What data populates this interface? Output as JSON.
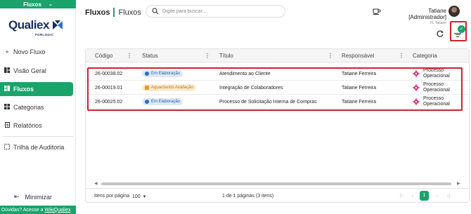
{
  "module": {
    "label": "Fluxos"
  },
  "logo": {
    "text": "Qualiex",
    "subtext": "FORLOGIC"
  },
  "sidebar": {
    "items": [
      {
        "icon": "plus-icon",
        "label": "Novo Fluxo"
      },
      {
        "icon": "dashboard-icon",
        "label": "Visão Geral"
      },
      {
        "icon": "flows-icon",
        "label": "Fluxos",
        "active": true
      },
      {
        "icon": "categories-icon",
        "label": "Categorias"
      },
      {
        "icon": "report-icon",
        "label": "Relatórios"
      },
      {
        "icon": "audit-trail-icon",
        "label": "Trilha de Auditoria"
      }
    ],
    "minimize_label": "Minimizar",
    "footer_prefix": "Dúvidas? Acesse a",
    "footer_link": "WikiQualiex"
  },
  "header": {
    "title": "Fluxos",
    "breadcrumb": "Fluxos",
    "search_placeholder": "Digite para buscar...",
    "user_name": "Tatiane [Administrador]",
    "user_org": "FL Tatiane"
  },
  "filter": {
    "badge": "✓"
  },
  "table": {
    "columns": [
      "Código",
      "Status",
      "Título",
      "Responsável",
      "Categoria"
    ],
    "rows": [
      {
        "code": "26-00038.02",
        "status": "Em Elaboração",
        "status_color": "blue",
        "title": "Atendimento ao Cliente",
        "owner": "Tatiane Ferreira",
        "category_line1": "Processo",
        "category_line2": "Operacional"
      },
      {
        "code": "26-00019.01",
        "status": "Aguardando Avaliação",
        "status_color": "orange",
        "title": "Integração de Colaboradores",
        "owner": "Tatiane Ferreira",
        "category_line1": "Processo",
        "category_line2": "Operacional"
      },
      {
        "code": "26-00025.02",
        "status": "Em Elaboração",
        "status_color": "blue",
        "title": "Processo de Solicitação Interna de Compras",
        "owner": "Tatiane Ferreira",
        "category_line1": "Processo",
        "category_line2": "Operacional"
      }
    ]
  },
  "paginator": {
    "items_per_page_label": "Itens por página",
    "page_size": "100",
    "range_label": "1 de 1 páginas (3 itens)",
    "current_page": "1"
  },
  "colors": {
    "accent": "#1aa36b",
    "highlight": "#d0202a",
    "brand": "#1b2c5e"
  }
}
